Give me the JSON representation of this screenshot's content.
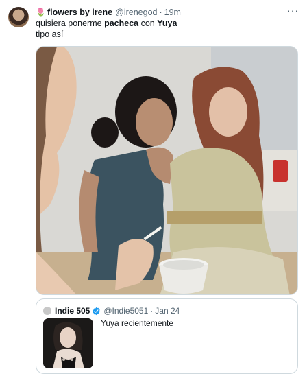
{
  "tweet": {
    "flower_icon": "🌷",
    "display_name": "flowers by irene",
    "handle": "@irenegod",
    "separator": "·",
    "time": "19m",
    "line1_part1": "quisiera ponerme ",
    "line1_bold1": "pacheca",
    "line1_part2": " con ",
    "line1_bold2": "Yuya",
    "line2": "tipo así",
    "more_icon": "more-icon",
    "media_icon": "photo"
  },
  "quote": {
    "display_name": "Indie 505",
    "verified_icon": "verified-badge-icon",
    "verified_color": "#1d9bf0",
    "handle": "@Indie5051",
    "separator": "·",
    "date": "Jan 24",
    "text": "Yuya recientemente"
  }
}
